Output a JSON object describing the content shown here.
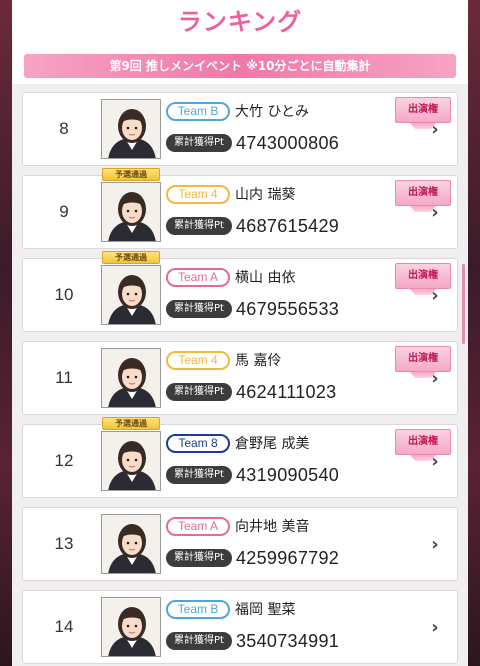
{
  "header": {
    "title": "ランキング",
    "subtitle": "第9回 推しメンイベント ※10分ごとに自動集計"
  },
  "labels": {
    "points_label": "累計獲得Pt",
    "appearance_badge": "出演権",
    "qualified_badge": "予選通過"
  },
  "colors": {
    "accent_pink": "#ee5f9b",
    "team_b": "#4fa6d9",
    "team_4": "#f2b93b",
    "team_a": "#e56a9a",
    "team_8": "#1d3c8f"
  },
  "icons": {
    "chevron": "chevron-right-icon"
  },
  "ranking": [
    {
      "rank": "8",
      "team": "Team B",
      "team_key": "b",
      "name": "大竹 ひとみ",
      "points": "4743000806",
      "qualified": false,
      "appearance": true
    },
    {
      "rank": "9",
      "team": "Team 4",
      "team_key": "4",
      "name": "山内 瑞葵",
      "points": "4687615429",
      "qualified": true,
      "appearance": true
    },
    {
      "rank": "10",
      "team": "Team A",
      "team_key": "a",
      "name": "横山 由依",
      "points": "4679556533",
      "qualified": true,
      "appearance": true
    },
    {
      "rank": "11",
      "team": "Team 4",
      "team_key": "4",
      "name": "馬 嘉伶",
      "points": "4624111023",
      "qualified": false,
      "appearance": true
    },
    {
      "rank": "12",
      "team": "Team 8",
      "team_key": "8",
      "name": "倉野尾 成美",
      "points": "4319090540",
      "qualified": true,
      "appearance": true
    },
    {
      "rank": "13",
      "team": "Team A",
      "team_key": "a",
      "name": "向井地 美音",
      "points": "4259967792",
      "qualified": false,
      "appearance": false
    },
    {
      "rank": "14",
      "team": "Team B",
      "team_key": "b",
      "name": "福岡 聖菜",
      "points": "3540734991",
      "qualified": false,
      "appearance": false
    }
  ]
}
